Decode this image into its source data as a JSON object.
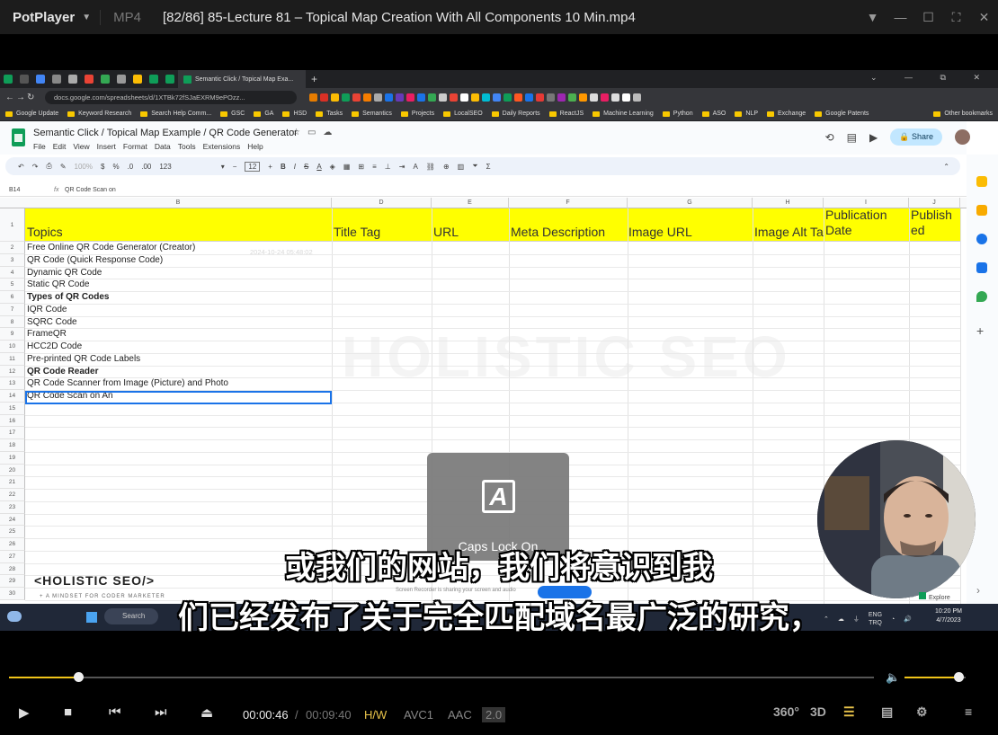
{
  "player": {
    "app_name": "PotPlayer",
    "format": "MP4",
    "file_title": "[82/86] 85-Lecture 81 – Topical Map Creation With All Components 10 Min.mp4",
    "time_current": "00:00:46",
    "time_separator": "/",
    "time_total": "00:09:40",
    "tag_hw": "H/W",
    "tag_video": "AVC1",
    "tag_audio": "AAC",
    "tag_version": "2.0",
    "btn_360": "360°",
    "btn_3d": "3D",
    "progress_fraction": 0.08,
    "volume_fraction": 0.88,
    "accent_color": "#f0c419"
  },
  "browser": {
    "active_tab": "Semantic Click / Topical Map Exa...",
    "url": "docs.google.com/spreadsheets/d/1XTBk72fSJaEXRM9ePOzz...",
    "bookmarks": [
      "Google Update",
      "Keyword Research",
      "Search Help Comm...",
      "GSC",
      "GA",
      "HSD",
      "Tasks",
      "Semantics",
      "Projects",
      "LocalSEO",
      "Daily Reports",
      "ReactJS",
      "Machine Learning",
      "Python",
      "ASO",
      "NLP",
      "Exchange",
      "Google Patents"
    ],
    "other_bookmarks": "Other bookmarks"
  },
  "sheets": {
    "doc_title": "Semantic Click / Topical Map Example / QR Code Generator",
    "menus": [
      "File",
      "Edit",
      "View",
      "Insert",
      "Format",
      "Data",
      "Tools",
      "Extensions",
      "Help"
    ],
    "share_label": "Share",
    "zoom": "100%",
    "font_size": "12",
    "currency": "$",
    "percent": "%",
    "decimal_dec": ".0",
    "decimal_inc": ".00",
    "number_format": "123",
    "cell_ref": "B14",
    "formula": "QR Code Scan on",
    "columns": [
      "B",
      "D",
      "E",
      "F",
      "G",
      "H",
      "I",
      "J"
    ],
    "header": {
      "topics": "Topics",
      "title_tag": "Title Tag",
      "url": "URL",
      "meta_description": "Meta Description",
      "image_url": "Image URL",
      "image_alt": "Image Alt Ta",
      "publication_date": "Publication Date",
      "published": "Publish ed"
    },
    "timestamp": "2024-10-24 05:48:02",
    "rows": [
      {
        "n": "2",
        "text": "Free Online QR Code Generator (Creator)",
        "bold": false
      },
      {
        "n": "3",
        "text": "QR Code (Quick Response Code)",
        "bold": false
      },
      {
        "n": "4",
        "text": "Dynamic QR Code",
        "bold": false
      },
      {
        "n": "5",
        "text": "Static QR Code",
        "bold": false
      },
      {
        "n": "6",
        "text": "Types of QR Codes",
        "bold": true
      },
      {
        "n": "7",
        "text": "IQR Code",
        "bold": false
      },
      {
        "n": "8",
        "text": "SQRC Code",
        "bold": false
      },
      {
        "n": "9",
        "text": "FrameQR",
        "bold": false
      },
      {
        "n": "10",
        "text": "HCC2D Code",
        "bold": false
      },
      {
        "n": "11",
        "text": "Pre-printed QR Code Labels",
        "bold": false
      },
      {
        "n": "12",
        "text": "QR Code Reader",
        "bold": true
      },
      {
        "n": "13",
        "text": "QR Code Scanner from Image (Picture) and Photo",
        "bold": false
      },
      {
        "n": "14",
        "text": "QR Code Scan on An",
        "bold": false
      }
    ],
    "empty_rows": [
      "15",
      "16",
      "17",
      "18",
      "19",
      "20",
      "21",
      "22",
      "23",
      "24",
      "25",
      "26",
      "27",
      "28",
      "29",
      "30"
    ]
  },
  "overlay": {
    "caps_lock": "Caps Lock On",
    "logo": "<HOLISTIC SEO/>",
    "logo_sub": "+ A MINDSET FOR CODER MARKETER",
    "screen_reader": "Screen Recorder is sharing your screen and audio",
    "explore": "Explore"
  },
  "taskbar": {
    "search": "Search",
    "lang": "ENG",
    "region": "TRQ",
    "time": "10:20 PM",
    "date": "4/7/2023"
  },
  "subtitles": {
    "line1": "或我们的网站，我们将意识到我",
    "line2": "们已经发布了关于完全匹配域名最广泛的研究，"
  }
}
